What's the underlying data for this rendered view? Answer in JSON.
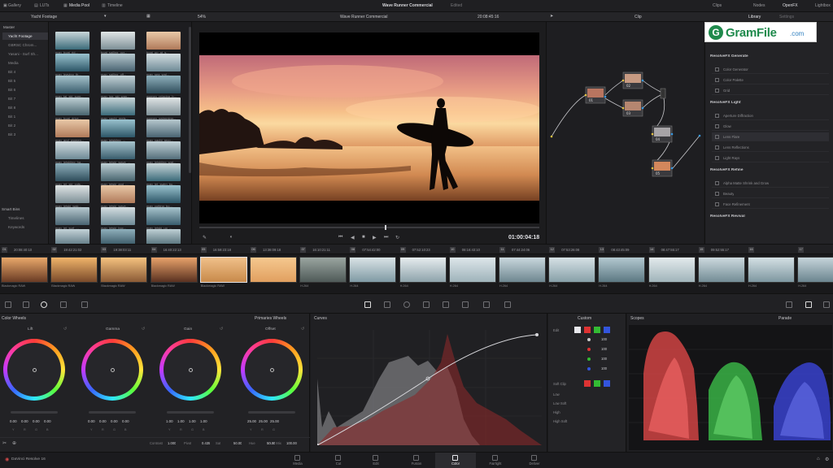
{
  "top_tabs": {
    "gallery": "Gallery",
    "luts": "LUTs",
    "media_pool": "Media Pool",
    "timeline": "Timeline"
  },
  "project_title": "Wave Runner Commercial",
  "project_state": "Edited",
  "top_right": {
    "clips": "Clips",
    "nodes": "Nodes",
    "openfx": "OpenFX",
    "lightbox": "Lightbox"
  },
  "pool_header": {
    "folder": "Yacht Footage",
    "zoom": "54%",
    "timecode": "20:08:45:16"
  },
  "sidebar": {
    "master": "Master",
    "items": [
      "Yacht Footage",
      "GBRSC Chrom...",
      "Yasani - Surf Sh...",
      "Media",
      "Bit 4",
      "Bit 5",
      "Bit 6",
      "Bit 7",
      "Bit 8",
      "Bit 1",
      "Bit 2",
      "Bit 3"
    ],
    "smart_bins": "Smart Bins",
    "smart_items": [
      "Timelines",
      "Keywords"
    ]
  },
  "pool_clips": [
    [
      "man_boat_rid...",
      "boat_sailing_ocr...",
      "boat_up_at_s..."
    ],
    [
      "man_leaving_th...",
      "man_sailing_off...",
      "man_sea_wal..."
    ],
    [
      "man_tai_ski_sunr...",
      "man_jug_ski_wan...",
      "women_relaxing_b..."
    ],
    [
      "man_boat_drive...",
      "man_yacht_reels...",
      "women_swimming..."
    ],
    [
      "man_and_women...",
      "man_jetskiing_...",
      "man_yacht_reco..."
    ],
    [
      "man_jetskiing_ha...",
      "man_jetski_wave_...",
      "man_jetskiing_wat..."
    ],
    [
      "man_jet_ski_cuts...",
      "man_jetski_and_...",
      "man_jet_swim_bu..."
    ],
    [
      "man_jetski_wak...",
      "man_jetski_wave...",
      "man_cutting_bo..."
    ],
    [
      "man_jet_surf_...",
      "man_jetski_buc...",
      "man_jetski_up_..."
    ],
    [
      "man_pulling_up_...",
      "man_pulling_up_...",
      "man_pulling_up_..."
    ]
  ],
  "viewer": {
    "title": "Wave Runner Commercial",
    "timecode": "01:00:04:18"
  },
  "node_panel": {
    "mode": "Clip",
    "node_labels": [
      "01",
      "02",
      "03",
      "04",
      "05"
    ]
  },
  "library": {
    "tab_library": "Library",
    "tab_settings": "Settings",
    "sections": [
      {
        "title": "ResolveFX Generate",
        "items": [
          "Color Generator",
          "Color Palette",
          "Grid"
        ]
      },
      {
        "title": "ResolveFX Light",
        "items": [
          "Aperture Diffraction",
          "Glow",
          "Lens Flare",
          "Lens Reflections",
          "Light Rays"
        ]
      },
      {
        "title": "ResolveFX Refine",
        "items": [
          "Alpha Matte Shrink and Grow",
          "Beauty",
          "Face Refinement"
        ]
      },
      {
        "title": "ResolveFX Revival",
        "items": []
      }
    ]
  },
  "watermark": {
    "text": "GramFile",
    "suffix": ".com",
    "mark": "G"
  },
  "timeline_strip": {
    "timecodes": [
      "20:08:40:10",
      "19:42:21:02",
      "19:38:03:11",
      "16:40:22:13",
      "16:59:23:18",
      "13:38:09:18",
      "16:10:21:11",
      "07:54:42:00",
      "07:52:10:23",
      "08:16:43:10",
      "07:44:24:06",
      "07:53:26:08",
      "08:43:45:09",
      "08:47:55:17",
      "09:52:55:17"
    ],
    "numbers": [
      "01",
      "02",
      "03",
      "04",
      "05",
      "06",
      "07",
      "08",
      "09",
      "10",
      "11",
      "12",
      "13",
      "14",
      "15",
      "16",
      "17"
    ]
  },
  "clip_strip_labels": [
    "Blackmagic RAW",
    "Blackmagic RAW",
    "Blackmagic RAW",
    "Blackmagic RAW",
    "Blackmagic RAW",
    "",
    "H.264",
    "H.264",
    "H.264",
    "H.264",
    "H.264",
    "H.264",
    "H.264",
    "H.264",
    "H.264",
    "H.264",
    "H.264"
  ],
  "color_wheels": {
    "title": "Color Wheels",
    "mode": "Primaries Wheels",
    "wheels": [
      {
        "name": "Lift",
        "values": [
          "0.00",
          "0.00",
          "0.00",
          "0.00"
        ]
      },
      {
        "name": "Gamma",
        "values": [
          "0.00",
          "0.00",
          "0.00",
          "0.00"
        ]
      },
      {
        "name": "Gain",
        "values": [
          "1.00",
          "1.00",
          "1.00",
          "1.00"
        ]
      },
      {
        "name": "Offset",
        "values": [
          "25.00",
          "25.00",
          "25.00"
        ]
      }
    ],
    "channel_letters": [
      "Y",
      "R",
      "G",
      "B"
    ],
    "footer": [
      {
        "label": "Contrast",
        "value": "1.000"
      },
      {
        "label": "Pivot",
        "value": "0.435"
      },
      {
        "label": "Sat",
        "value": "50.00"
      },
      {
        "label": "Hue",
        "value": "50.00"
      },
      {
        "label": "Lum Mix",
        "value": "100.00"
      }
    ]
  },
  "curves": {
    "title": "Curves"
  },
  "custom_panel": {
    "title": "Custom",
    "edit": "Edit",
    "values": [
      "100",
      "100",
      "100",
      "100"
    ],
    "soft_clip": "Soft Clip",
    "soft_rows": [
      "Low",
      "Low Soft",
      "High",
      "High Soft"
    ]
  },
  "scopes": {
    "title": "Scopes",
    "mode": "Parade"
  },
  "pages": [
    "Media",
    "Cut",
    "Edit",
    "Fusion",
    "Color",
    "Fairlight",
    "Deliver"
  ],
  "active_page": "Color",
  "app_name": "DaVinci Resolve 16"
}
